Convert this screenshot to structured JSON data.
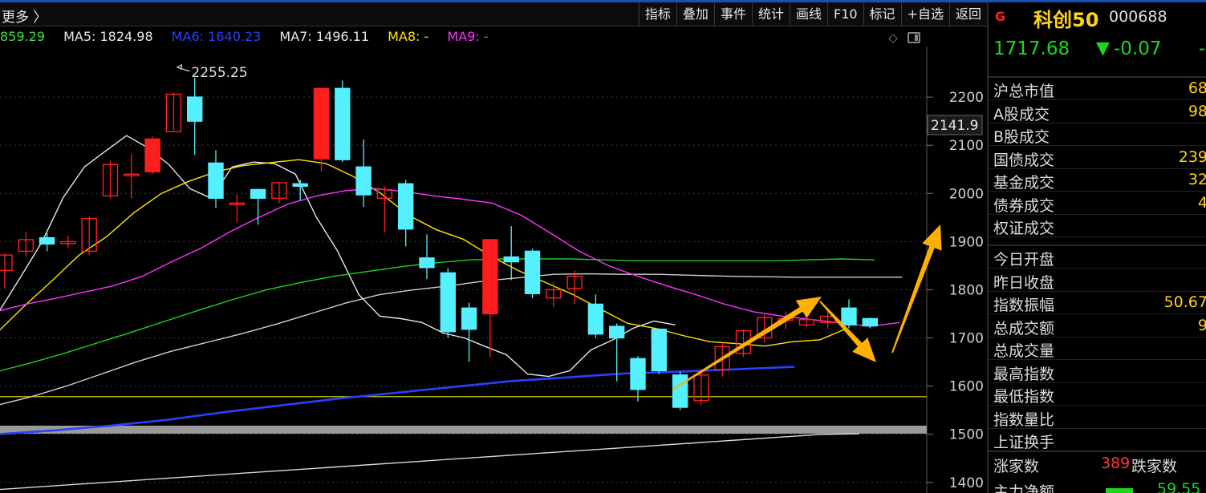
{
  "toolbar": {
    "more_link": "更多 〉",
    "buttons": [
      "指标",
      "叠加",
      "事件",
      "统计",
      "画线",
      "F10",
      "标记",
      "+自选",
      "返回"
    ]
  },
  "ma_line": {
    "items": [
      {
        "label": "",
        "value": "859.29",
        "color": "#3fe03f"
      },
      {
        "label": "MA5: ",
        "value": "1824.98",
        "color": "#e8e8e8"
      },
      {
        "label": "MA6: ",
        "value": "1640.23",
        "color": "#2a40ff"
      },
      {
        "label": "MA7: ",
        "value": "1496.11",
        "color": "#e8e8e8"
      },
      {
        "label": "MA8: ",
        "value": "-",
        "color": "#ffe600"
      },
      {
        "label": "MA9: ",
        "value": "-",
        "color": "#ff33ff"
      }
    ]
  },
  "chart_data": {
    "type": "candlestick",
    "y_ticks": [
      2200,
      2100,
      2000,
      1900,
      1800,
      1700,
      1600,
      1500,
      1400
    ],
    "y_range": [
      1378,
      2305
    ],
    "current_price_label": "2141.9",
    "current_price_value": 2141.9,
    "high_annotation": "2255.25",
    "high_annotation_value": 2255.25,
    "high_annotation_index": 8,
    "horizontal_line_value": 1578,
    "up_color": "#ff1e1e",
    "down_color": "#54f0ff",
    "candles": [
      [
        1840,
        1872,
        1802,
        1876
      ],
      [
        1880,
        1904,
        1870,
        1920
      ],
      [
        1908,
        1895,
        1880,
        1918
      ],
      [
        1896,
        1900,
        1887,
        1912
      ],
      [
        1880,
        1948,
        1872,
        1952
      ],
      [
        1995,
        2060,
        1990,
        2068
      ],
      [
        2040,
        2040,
        1990,
        2082
      ],
      [
        2045,
        2113,
        2040,
        2118
      ],
      [
        2128,
        2206,
        2130,
        2210
      ],
      [
        2200,
        2150,
        2080,
        2240
      ],
      [
        2063,
        1990,
        1970,
        2090
      ],
      [
        1980,
        1980,
        1940,
        1998
      ],
      [
        2008,
        1990,
        1935,
        2010
      ],
      [
        1990,
        2022,
        1980,
        2024
      ],
      [
        2020,
        2015,
        1985,
        2028
      ],
      [
        2072,
        2218,
        2046,
        2218
      ],
      [
        2218,
        2070,
        2065,
        2234
      ],
      [
        2055,
        1997,
        1972,
        2112
      ],
      [
        1990,
        2008,
        1920,
        2015
      ],
      [
        2020,
        1926,
        1890,
        2028
      ],
      [
        1866,
        1846,
        1822,
        1915
      ],
      [
        1835,
        1713,
        1700,
        1845
      ],
      [
        1762,
        1718,
        1650,
        1773
      ],
      [
        1750,
        1904,
        1660,
        1905
      ],
      [
        1868,
        1858,
        1820,
        1932
      ],
      [
        1880,
        1792,
        1782,
        1885
      ],
      [
        1783,
        1800,
        1765,
        1815
      ],
      [
        1803,
        1828,
        1770,
        1840
      ],
      [
        1770,
        1708,
        1700,
        1790
      ],
      [
        1724,
        1700,
        1610,
        1730
      ],
      [
        1657,
        1593,
        1568,
        1662
      ],
      [
        1718,
        1632,
        1625,
        1720
      ],
      [
        1623,
        1556,
        1550,
        1630
      ],
      [
        1570,
        1623,
        1560,
        1635
      ],
      [
        1634,
        1682,
        1620,
        1690
      ],
      [
        1668,
        1715,
        1660,
        1718
      ],
      [
        1700,
        1742,
        1690,
        1748
      ],
      [
        1738,
        1740,
        1718,
        1755
      ],
      [
        1727,
        1738,
        1722,
        1748
      ],
      [
        1732,
        1745,
        1720,
        1758
      ],
      [
        1762,
        1727,
        1720,
        1780
      ],
      [
        1740,
        1725,
        1720,
        1742
      ]
    ],
    "lines": [
      {
        "name": "MA5",
        "color": "#e8e8e8",
        "values": [
          1758,
          1828,
          1900,
          1992,
          2055,
          2088,
          2120,
          2095,
          2060,
          2010,
          1990,
          2055,
          2065,
          2062,
          2040,
          1950,
          1880,
          1790,
          1745,
          1740,
          1732,
          1710,
          1700,
          1682,
          1665,
          1625,
          1620,
          1632,
          1675,
          1695,
          1720,
          1735,
          1727
        ]
      },
      {
        "name": "MA6",
        "color": "#2a40ff",
        "values": [
          1500,
          1508,
          1518,
          1530,
          1546,
          1560,
          1574,
          1586,
          1598,
          1610,
          1618,
          1626,
          1630,
          1635,
          1640
        ]
      },
      {
        "name": "MA7",
        "color": "#cfcfcf",
        "values": [
          1560,
          1578,
          1600,
          1625,
          1650,
          1672,
          1690,
          1708,
          1728,
          1750,
          1772,
          1790,
          1800,
          1808,
          1818,
          1825,
          1832,
          1833,
          1832,
          1832,
          1830,
          1828,
          1827,
          1826,
          1826,
          1826,
          1826
        ]
      },
      {
        "name": "MA8",
        "color": "#ffe600",
        "values": [
          1710,
          1766,
          1818,
          1872,
          1910,
          1960,
          2000,
          2025,
          2045,
          2058,
          2064,
          2070,
          2062,
          2035,
          2000,
          1955,
          1925,
          1905,
          1870,
          1840,
          1815,
          1790,
          1760,
          1730,
          1720,
          1705,
          1692,
          1688,
          1683,
          1692,
          1696,
          1720
        ]
      },
      {
        "name": "MA9",
        "color": "#ff33ff",
        "values": [
          1755,
          1770,
          1782,
          1795,
          1808,
          1828,
          1858,
          1886,
          1920,
          1950,
          1978,
          1995,
          2006,
          2010,
          2004,
          1995,
          1988,
          1980,
          1955,
          1918,
          1880,
          1850,
          1828,
          1808,
          1790,
          1770,
          1754,
          1745,
          1738,
          1731,
          1724,
          1732
        ]
      },
      {
        "name": "green",
        "color": "#20d020",
        "values": [
          1630,
          1648,
          1668,
          1690,
          1712,
          1735,
          1758,
          1780,
          1800,
          1815,
          1828,
          1838,
          1848,
          1856,
          1862,
          1864,
          1864,
          1864,
          1862,
          1860,
          1860,
          1860,
          1860,
          1860,
          1862,
          1864,
          1862
        ]
      },
      {
        "name": "lower",
        "color": "#d8d8d8",
        "values": [
          1378,
          1384,
          1390,
          1396,
          1402,
          1408,
          1414,
          1420,
          1426,
          1432,
          1438,
          1444,
          1450,
          1456,
          1462,
          1468,
          1474,
          1480,
          1486,
          1492,
          1498,
          1500
        ]
      }
    ]
  },
  "panel": {
    "badge": "G",
    "name": "科创50",
    "code": "000688",
    "price": "1717.68",
    "change_arrow": "▼",
    "change": "-0.07",
    "pct": "-",
    "group1": [
      {
        "label": "沪总市值",
        "value": "68"
      },
      {
        "label": "A股成交",
        "value": "98"
      },
      {
        "label": "B股成交",
        "value": ""
      },
      {
        "label": "国债成交",
        "value": "239"
      },
      {
        "label": "基金成交",
        "value": "32"
      },
      {
        "label": "债券成交",
        "value": "4"
      },
      {
        "label": "权证成交",
        "value": ""
      }
    ],
    "group2": [
      {
        "label": "今日开盘",
        "value": ""
      },
      {
        "label": "昨日收盘",
        "value": ""
      },
      {
        "label": "指数振幅",
        "value": "50.67"
      },
      {
        "label": "总成交额",
        "value": "9"
      },
      {
        "label": "总成交量",
        "value": ""
      },
      {
        "label": "最高指数",
        "value": ""
      },
      {
        "label": "最低指数",
        "value": ""
      },
      {
        "label": "指数量比",
        "value": ""
      },
      {
        "label": "上证换手",
        "value": ""
      }
    ],
    "adv_label": "涨家数",
    "adv_value": "389",
    "dec_label": "跌家数",
    "flow_label": "主力净额",
    "flow_value": "59.55"
  }
}
